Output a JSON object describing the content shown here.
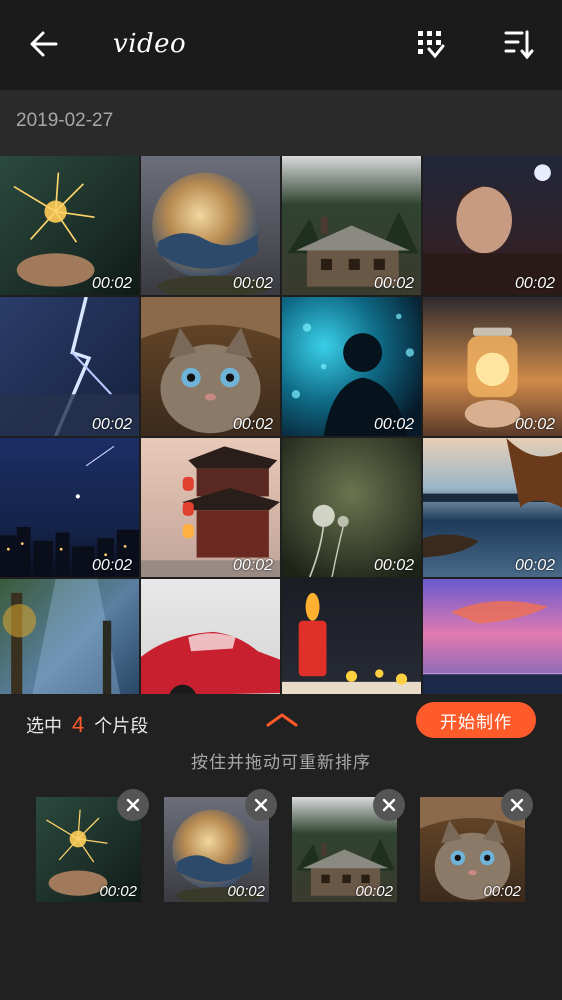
{
  "header": {
    "title": "video",
    "back_icon": "arrow-left-icon",
    "select_icon": "multi-select-icon",
    "sort_icon": "sort-icon"
  },
  "date_section": {
    "date": "2019-02-27"
  },
  "grid": {
    "items": [
      {
        "name": "sparkler",
        "duration": "00:02"
      },
      {
        "name": "crystal-ball",
        "duration": "00:02"
      },
      {
        "name": "cabin-in-forest",
        "duration": "00:02"
      },
      {
        "name": "man-portrait",
        "duration": "00:02"
      },
      {
        "name": "lightning",
        "duration": "00:02"
      },
      {
        "name": "cat",
        "duration": "00:02"
      },
      {
        "name": "silhouette-lights",
        "duration": "00:02"
      },
      {
        "name": "jar-of-lights",
        "duration": "00:02"
      },
      {
        "name": "city-night",
        "duration": "00:02"
      },
      {
        "name": "pagoda-lanterns",
        "duration": "00:02"
      },
      {
        "name": "dandelion",
        "duration": "00:02"
      },
      {
        "name": "lake-sunset",
        "duration": "00:02"
      },
      {
        "name": "forest-light",
        "duration": ""
      },
      {
        "name": "red-car",
        "duration": ""
      },
      {
        "name": "birthday-candle",
        "duration": ""
      },
      {
        "name": "pink-sky",
        "duration": ""
      }
    ]
  },
  "panel": {
    "selected_prefix": "选中",
    "selected_count": "4",
    "selected_suffix": "个片段",
    "start_button": "开始制作",
    "hint": "按住并拖动可重新排序",
    "selected": [
      {
        "name": "sparkler",
        "duration": "00:02"
      },
      {
        "name": "crystal-ball",
        "duration": "00:02"
      },
      {
        "name": "cabin-in-forest",
        "duration": "00:02"
      },
      {
        "name": "cat",
        "duration": "00:02"
      }
    ]
  },
  "colors": {
    "accent": "#ff5a2a",
    "background": "#1e1e1e"
  }
}
